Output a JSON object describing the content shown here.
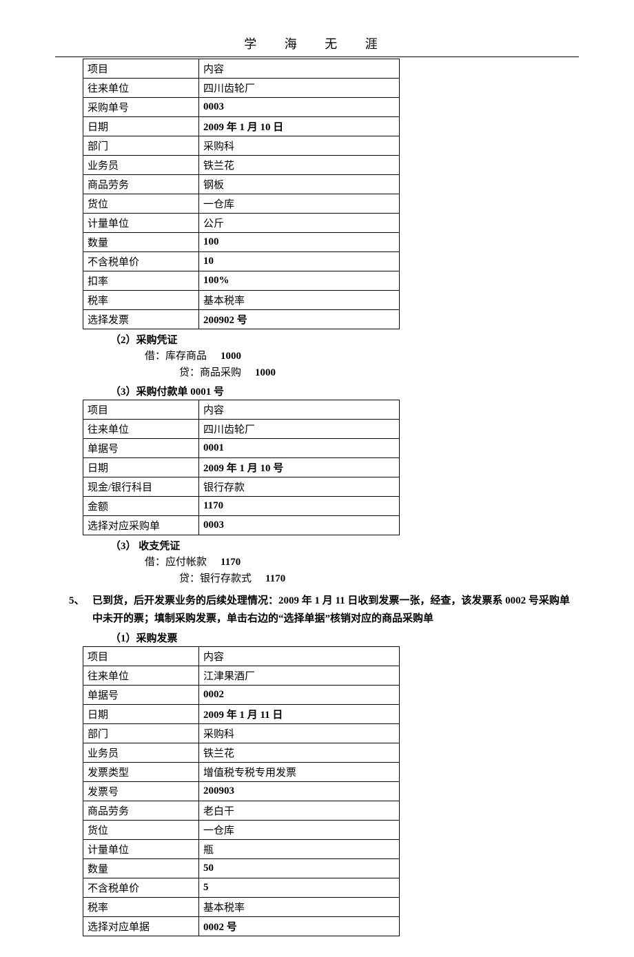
{
  "header": {
    "title": "学 海 无 涯"
  },
  "table1": {
    "rows": [
      [
        "项目",
        "内容"
      ],
      [
        "往来单位",
        "四川齿轮厂"
      ],
      [
        "采购单号",
        "0003"
      ],
      [
        "日期",
        "2009 年 1 月 10 日"
      ],
      [
        "部门",
        "采购科"
      ],
      [
        "业务员",
        "铁兰花"
      ],
      [
        "商品劳务",
        "钢板"
      ],
      [
        "货位",
        "一仓库"
      ],
      [
        "计量单位",
        "公斤"
      ],
      [
        "数量",
        "100"
      ],
      [
        "不含税单价",
        "10"
      ],
      [
        "扣率",
        "100%"
      ],
      [
        "税率",
        "基本税率"
      ],
      [
        "选择发票",
        "200902 号"
      ]
    ]
  },
  "section2": {
    "title": "（2）采购凭证",
    "debit_label": "借：库存商品",
    "debit_amount": "1000",
    "credit_label": "贷：商品采购",
    "credit_amount": "1000"
  },
  "section3a": {
    "title": "（3）采购付款单 0001 号"
  },
  "table2": {
    "rows": [
      [
        "项目",
        "内容"
      ],
      [
        "往来单位",
        "四川齿轮厂"
      ],
      [
        "单据号",
        "0001"
      ],
      [
        "日期",
        "2009 年 1 月 10 号"
      ],
      [
        "现金/银行科目",
        "银行存款"
      ],
      [
        "金额",
        "1170"
      ],
      [
        "选择对应采购单",
        "0003"
      ]
    ]
  },
  "section3b": {
    "title": "（3）  收支凭证",
    "debit_label": "借：应付帐款",
    "debit_amount": "1170",
    "credit_label": "贷：银行存款式",
    "credit_amount": "1170"
  },
  "item5": {
    "num": "5、",
    "text": "已到货，后开发票业务的后续处理情况：2009 年 1 月 11 日收到发票一张，经查，该发票系 0002 号采购单中未开的票；填制采购发票，单击右边的“选择单据”核销对应的商品采购单"
  },
  "section5a": {
    "title": "（1）采购发票"
  },
  "table3": {
    "rows": [
      [
        "项目",
        "内容"
      ],
      [
        "往来单位",
        "江津果酒厂"
      ],
      [
        "单据号",
        "0002"
      ],
      [
        "日期",
        "2009 年 1 月 11 日"
      ],
      [
        "部门",
        "采购科"
      ],
      [
        "业务员",
        "铁兰花"
      ],
      [
        "发票类型",
        "增值税专税专用发票"
      ],
      [
        "发票号",
        "200903"
      ],
      [
        "商品劳务",
        "老白干"
      ],
      [
        "货位",
        "一仓库"
      ],
      [
        "计量单位",
        "瓶"
      ],
      [
        "数量",
        "50"
      ],
      [
        "不含税单价",
        "5"
      ],
      [
        "税率",
        "基本税率"
      ],
      [
        "选择对应单据",
        "0002 号"
      ]
    ]
  }
}
